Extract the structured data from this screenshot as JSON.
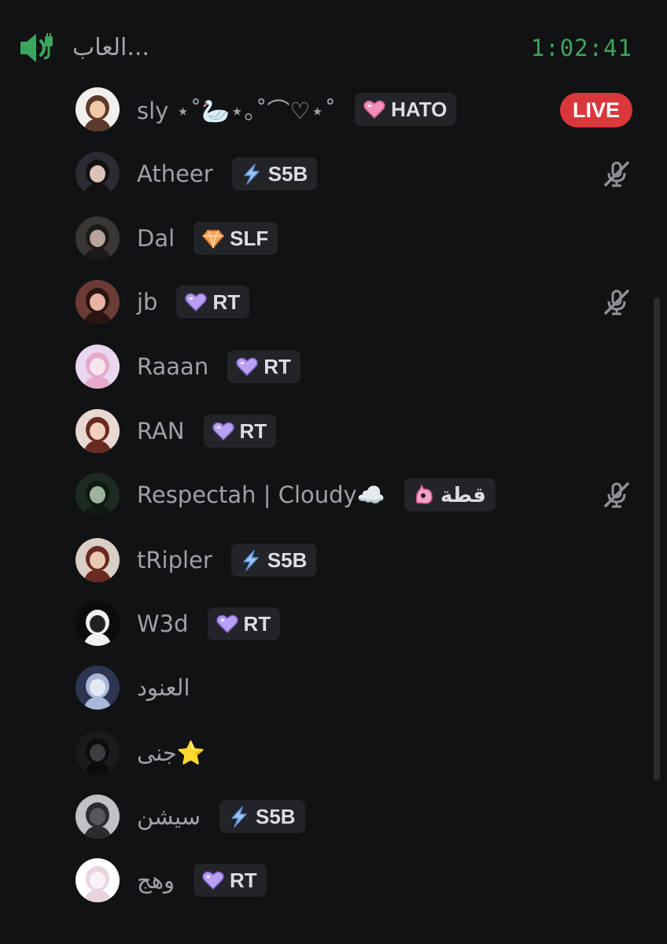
{
  "header": {
    "channel_name": "العاب...",
    "elapsed": "1:02:41",
    "icon": "speaker-icon"
  },
  "members": [
    {
      "name": "sly ⋆˚🦢⋆｡˚⌒♡⋆˚",
      "tag_icon": "pink-heart-icon",
      "tag": "HATO",
      "live": "LIVE",
      "muted": false
    },
    {
      "name": "Atheer",
      "tag_icon": "lightning-icon",
      "tag": "S5B",
      "muted": true
    },
    {
      "name": "Dal",
      "tag_icon": "gem-icon",
      "tag": "SLF",
      "muted": false
    },
    {
      "name": "jb",
      "tag_icon": "purple-heart-icon",
      "tag": "RT",
      "muted": true
    },
    {
      "name": "Raaan",
      "tag_icon": "purple-heart-icon",
      "tag": "RT",
      "muted": false
    },
    {
      "name": "RAN",
      "tag_icon": "purple-heart-icon",
      "tag": "RT",
      "muted": false
    },
    {
      "name": "Respectah | Cloudy☁️",
      "tag_icon": "pink-cat-icon",
      "tag": "قطة",
      "muted": true
    },
    {
      "name": "tRipler",
      "tag_icon": "lightning-icon",
      "tag": "S5B",
      "muted": false
    },
    {
      "name": "W3d",
      "tag_icon": "purple-heart-icon",
      "tag": "RT",
      "muted": false
    },
    {
      "name": "العنود",
      "muted": false
    },
    {
      "name": "جنى⭐",
      "muted": false
    },
    {
      "name": "سيشن",
      "tag_icon": "lightning-icon",
      "tag": "S5B",
      "muted": false
    },
    {
      "name": "وهج",
      "tag_icon": "purple-heart-icon",
      "tag": "RT",
      "muted": false
    }
  ],
  "colors": {
    "background": "#111214",
    "name_text": "#9ea1a8",
    "timer": "#3ba55d",
    "live_badge": "#da373c",
    "tag_bg": "#232428"
  }
}
